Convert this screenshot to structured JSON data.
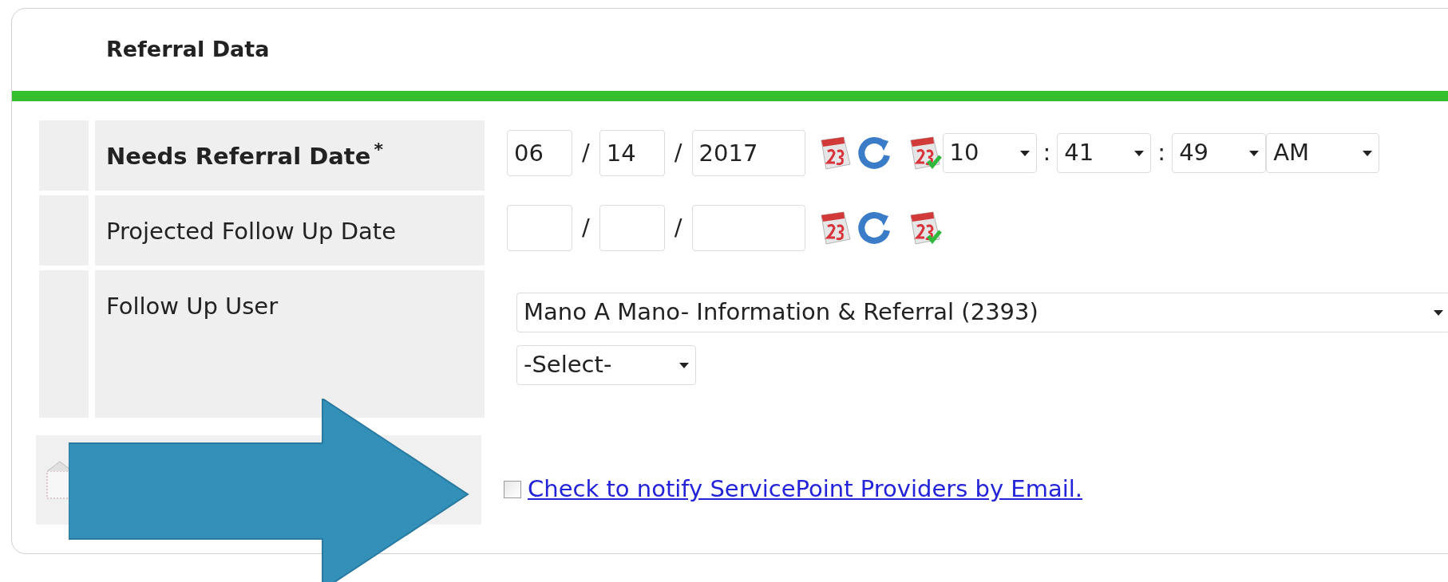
{
  "section": {
    "title": "Referral Data"
  },
  "fields": [
    {
      "kind": "datetime",
      "label": "Needs Referral Date",
      "required": true,
      "required_mark": "*",
      "date_values": [
        "06",
        "14",
        "2017"
      ],
      "date_separators": [
        "/",
        "/"
      ],
      "time": [
        "10",
        "41",
        "49",
        "AM"
      ],
      "time_separators": [
        ":",
        ":"
      ]
    },
    {
      "kind": "date",
      "label": "Projected Follow Up Date",
      "required": false,
      "date_separators": [
        "/",
        "/"
      ]
    },
    {
      "kind": "user",
      "label": "Follow Up User",
      "required": false,
      "value": "Mano A Mano- Information & Referral (2393)",
      "secondary": "-Select-"
    },
    {
      "kind": "notify",
      "checked": false,
      "link": "Check to notify ServicePoint Providers by Email."
    }
  ]
}
